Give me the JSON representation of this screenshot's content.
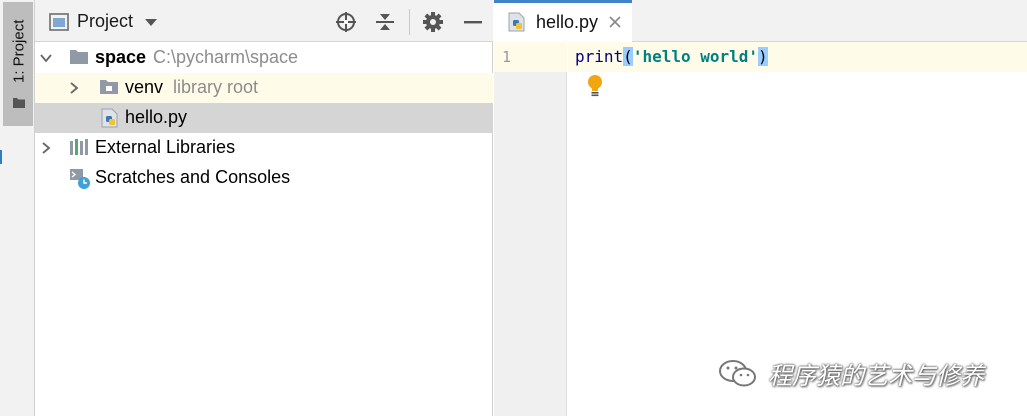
{
  "sidebar_stripe": {
    "label": "1: Project"
  },
  "project_panel": {
    "title": "Project",
    "tree": [
      {
        "name": "space",
        "hint": "C:\\pycharm\\space"
      },
      {
        "name": "venv",
        "hint": "library root"
      },
      {
        "name": "hello.py"
      },
      {
        "name": "External Libraries"
      },
      {
        "name": "Scratches and Consoles"
      }
    ]
  },
  "editor": {
    "tab": {
      "label": "hello.py"
    },
    "line_number": "1",
    "code": {
      "fn": "print",
      "open_paren": "(",
      "string": "'hello world'",
      "close_paren": ")"
    }
  },
  "watermark": {
    "text": "程序猿的艺术与修养"
  },
  "colors": {
    "accent": "#4083c9",
    "selection": "#d5d5d5",
    "current_line": "#fefce8",
    "string": "#008080"
  }
}
